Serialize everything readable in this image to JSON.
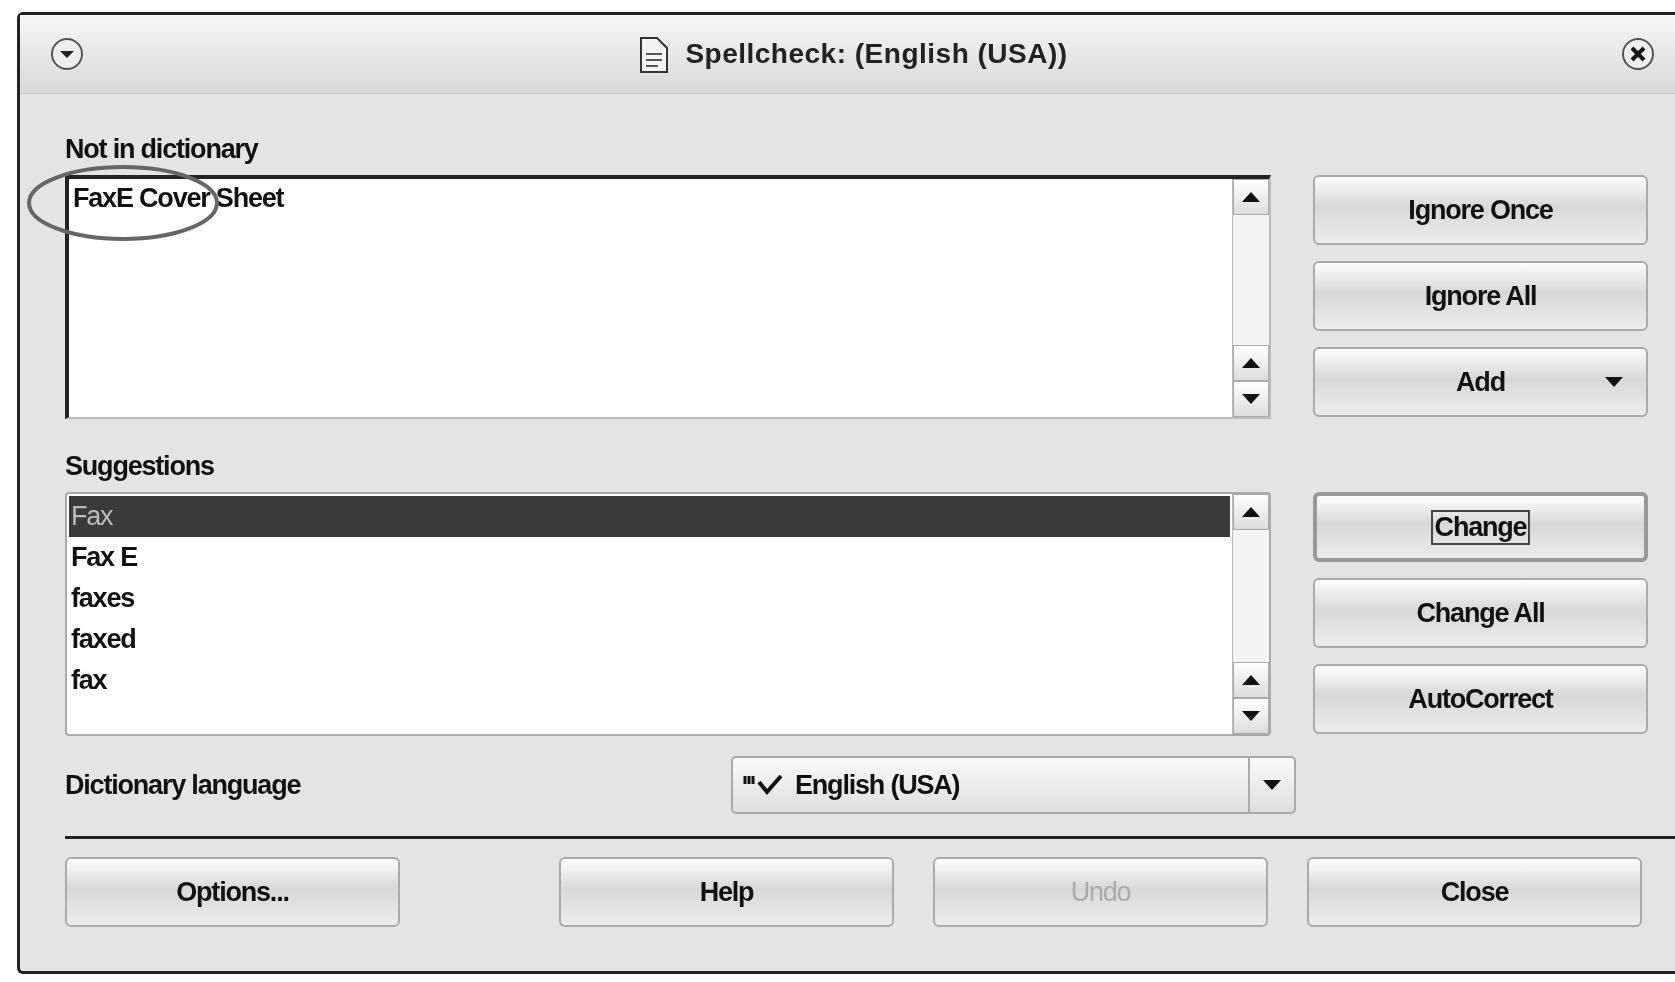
{
  "window": {
    "title": "Spellcheck: (English (USA))"
  },
  "not_in_dictionary": {
    "label": "Not in dictionary",
    "text": "FaxE Cover Sheet",
    "annotated": true
  },
  "side_buttons_top": [
    {
      "label": "Ignore Once",
      "has_menu": false,
      "default": false
    },
    {
      "label": "Ignore All",
      "has_menu": false,
      "default": false
    },
    {
      "label": "Add",
      "has_menu": true,
      "default": false
    }
  ],
  "suggestions": {
    "label": "Suggestions",
    "items": [
      {
        "text": "Fax",
        "selected": true
      },
      {
        "text": "Fax E",
        "selected": false
      },
      {
        "text": "faxes",
        "selected": false
      },
      {
        "text": "faxed",
        "selected": false
      },
      {
        "text": "fax",
        "selected": false
      }
    ]
  },
  "side_buttons_bottom": [
    {
      "label": "Change",
      "has_menu": false,
      "default": true
    },
    {
      "label": "Change All",
      "has_menu": false,
      "default": false
    },
    {
      "label": "AutoCorrect",
      "has_menu": false,
      "default": false
    }
  ],
  "dictionary_language": {
    "label": "Dictionary language",
    "value": "English (USA)"
  },
  "footer_buttons": [
    {
      "label": "Options...",
      "disabled": false
    },
    {
      "label": "Help",
      "disabled": false
    },
    {
      "label": "Undo",
      "disabled": true
    },
    {
      "label": "Close",
      "disabled": false
    }
  ]
}
